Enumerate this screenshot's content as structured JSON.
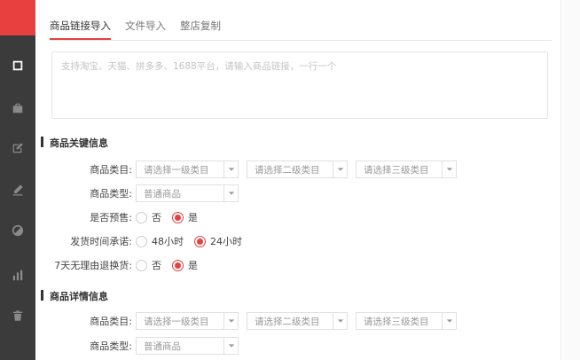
{
  "tabs": [
    "商品链接导入",
    "文件导入",
    "整店复制"
  ],
  "link_input": {
    "placeholder": "支持淘宝、天猫、拼多多、1688平台，请输入商品链接，一行一个"
  },
  "sections": {
    "key_info": {
      "title": "商品关键信息",
      "category_label": "商品类目:",
      "category_level1": "请选择一级类目",
      "category_level2": "请选择二级类目",
      "category_level3": "请选择三级类目",
      "type_label": "商品类型:",
      "type_value": "普通商品",
      "presale_label": "是否预售:",
      "presale_no": "否",
      "presale_yes": "是",
      "presale_selected": "是",
      "ship_label": "发货时间承诺:",
      "ship_48": "48小时",
      "ship_24": "24小时",
      "ship_selected": "24小时",
      "return_label": "7天无理由退换货:",
      "return_no": "否",
      "return_yes": "是",
      "return_selected": "是"
    },
    "detail_info": {
      "title": "商品详情信息",
      "category_label": "商品类目:",
      "category_level1": "请选择一级类目",
      "category_level2": "请选择二级类目",
      "category_level3": "请选择三级类目",
      "type_label": "商品类型:",
      "type_value": "普通商品"
    }
  },
  "colors": {
    "accent": "#e8403e",
    "sidebar": "#3b3b3b"
  },
  "sidebar_icons": [
    "import-icon",
    "bag-icon",
    "edit-box-icon",
    "pen-icon",
    "disabled-icon",
    "chart-icon",
    "trash-icon"
  ]
}
